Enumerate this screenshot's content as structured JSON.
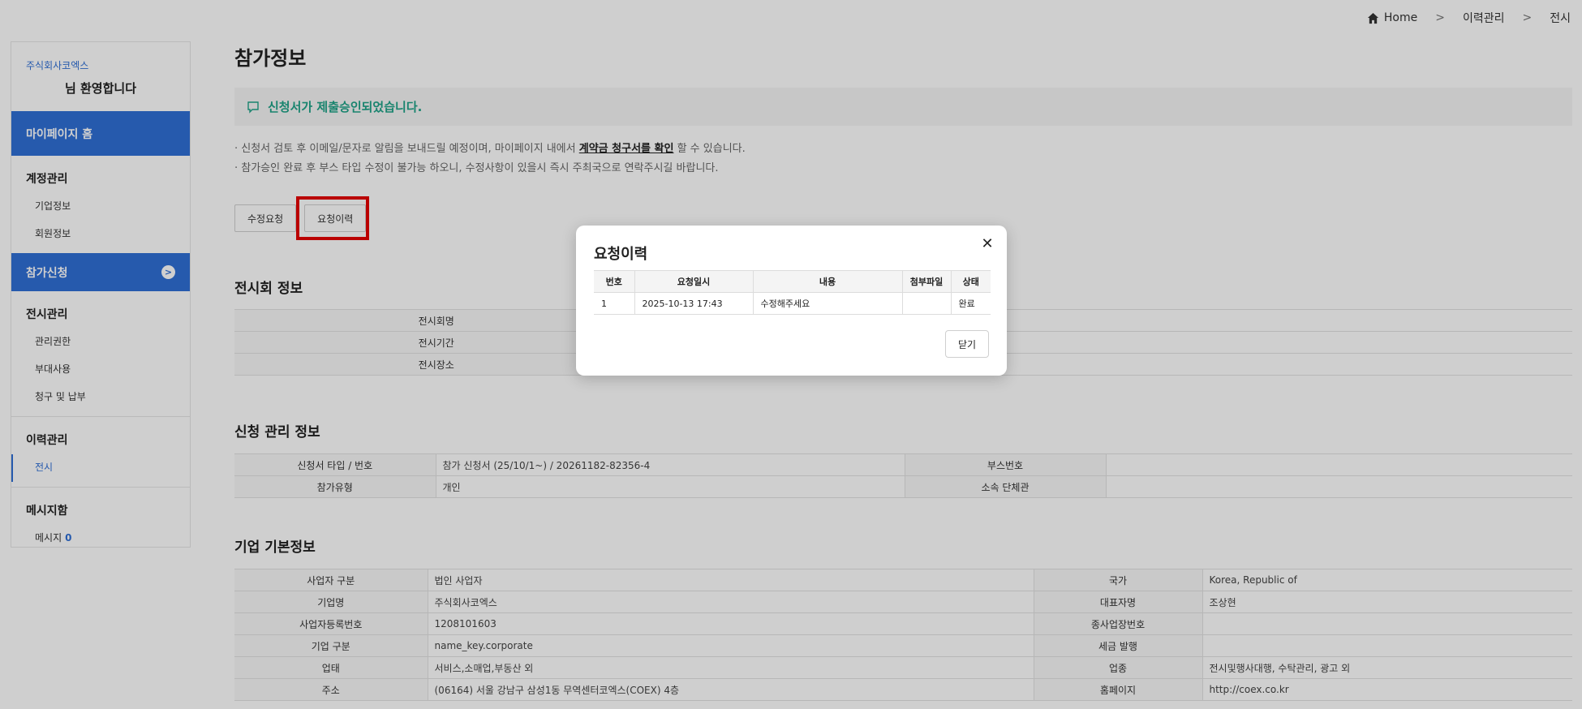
{
  "breadcrumb": {
    "home": "Home",
    "level1": "이력관리",
    "level2": "전시"
  },
  "sidebar": {
    "company": "주식회사코엑스",
    "welcome": "님 환영합니다",
    "mypage_home": "마이페이지 홈",
    "account_title": "계정관리",
    "account_items": [
      "기업정보",
      "회원정보"
    ],
    "apply": "참가신청",
    "exhibit_title": "전시관리",
    "exhibit_items": [
      "관리권한",
      "부대사용",
      "청구 및 납부"
    ],
    "history_title": "이력관리",
    "history_items": [
      "전시"
    ],
    "message_title": "메시지함",
    "message_label": "메시지",
    "message_count": "0"
  },
  "main": {
    "title": "참가정보",
    "notice": "신청서가 제출승인되었습니다.",
    "info_line1_pre": "· 신청서 검토 후 이메일/문자로 알림을 보내드릴 예정이며, 마이페이지 내에서",
    "info_line1_link": "계약금 청구서를 확인",
    "info_line1_post": "할 수 있습니다.",
    "info_line2": "· 참가승인 완료 후 부스 타입 수정이 불가능 하오니, 수정사항이 있을시 즉시 주최국으로 연락주시길 바랍니다.",
    "btn_edit": "수정요청",
    "btn_history": "요청이력"
  },
  "exhibition": {
    "title": "전시회 정보",
    "rows": [
      {
        "key": "전시회명",
        "value": ""
      },
      {
        "key": "전시기간",
        "value": ""
      },
      {
        "key": "전시장소",
        "value": ""
      }
    ]
  },
  "application": {
    "title": "신청 관리 정보",
    "rows": [
      {
        "k1": "신청서 타입 / 번호",
        "v1": "참가 신청서 (25/10/1~) / 20261182-82356-4",
        "k2": "부스번호",
        "v2": ""
      },
      {
        "k1": "참가유형",
        "v1": "개인",
        "k2": "소속 단체관",
        "v2": ""
      }
    ]
  },
  "company": {
    "title": "기업 기본정보",
    "rows": [
      {
        "k1": "사업자 구분",
        "v1": "법인 사업자",
        "k2": "국가",
        "v2": "Korea, Republic of"
      },
      {
        "k1": "기업명",
        "v1": "주식회사코엑스",
        "k2": "대표자명",
        "v2": "조상현"
      },
      {
        "k1": "사업자등록번호",
        "v1": "1208101603",
        "k2": "종사업장번호",
        "v2": ""
      },
      {
        "k1": "기업 구분",
        "v1": "name_key.corporate",
        "k2": "세금 발행",
        "v2": ""
      },
      {
        "k1": "업태",
        "v1": "서비스,소매업,부동산 외",
        "k2": "업종",
        "v2": "전시및행사대행, 수탁관리, 광고 외"
      },
      {
        "k1": "주소",
        "v1": "(06164) 서울 강남구 삼성1동 무역센터코엑스(COEX) 4층",
        "k2": "홈페이지",
        "v2": "http://coex.co.kr"
      }
    ]
  },
  "modal": {
    "title": "요청이력",
    "headers": [
      "번호",
      "요청일시",
      "내용",
      "첨부파일",
      "상태"
    ],
    "rows": [
      {
        "no": "1",
        "datetime": "2025-10-13 17:43",
        "content": "수정해주세요",
        "file": "",
        "status": "완료"
      }
    ],
    "close_label": "닫기"
  },
  "colors": {
    "accent": "#2f6fd6",
    "notice": "#1fa388",
    "highlight": "#e60000"
  }
}
